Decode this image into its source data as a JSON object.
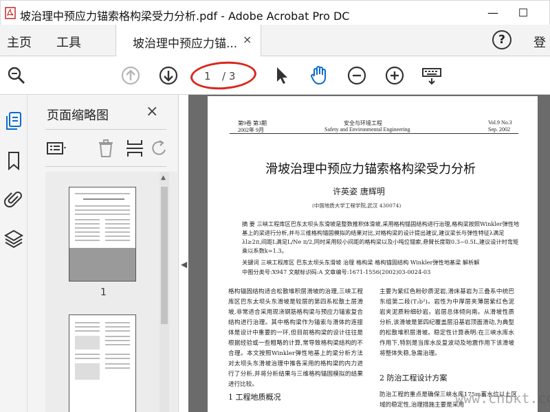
{
  "window": {
    "title": "坡治理中预应力锚索格构梁受力分析.pdf - Adobe Acrobat Pro DC",
    "minimize": "—",
    "maximize": "☐"
  },
  "menu": {
    "home": "主页",
    "tools": "工具",
    "doc_tab": "坡治理中预应力锚...",
    "doc_tab_close": "×",
    "help": "?",
    "login": "登"
  },
  "toolbar": {
    "current_page": "1",
    "total_pages": "/ 3",
    "icons": [
      "zoom-search-icon",
      "prev-page-icon",
      "next-page-icon",
      "select-arrow-icon",
      "hand-icon",
      "zoom-out-icon",
      "zoom-in-icon",
      "keyboard-icon"
    ]
  },
  "panel": {
    "title": "页面缩略图",
    "close": "×",
    "thumb_label": "1"
  },
  "colors": {
    "accent": "#0b6bcb",
    "highlight_ring": "#d9261c"
  },
  "page": {
    "header_left_1": "第9卷  第3期",
    "header_left_2": "2002年  9月",
    "header_center_1": "安全与环境工程",
    "header_center_2": "Safety and Environmental Engineering",
    "header_right_1": "Vol.9   No.3",
    "header_right_2": "Sep.   2002",
    "title": "滑坡治理中预应力锚索格构梁受力分析",
    "authors": "许英姿    唐辉明",
    "affiliation": "(中国地质大学工程学院,武汉 430074)",
    "abstract": "摘  要   三峡工程库区巴东太坝头东滑坡是整数推积体滑坡,采用格构锚固结构进行治理,格构梁按照Winkler弹性地基上的梁进行分析,并与三维格构锚固模拟的结果对比,对格构梁的设计提出建议,建议梁长与弹性特征λ满足λl≥2π,间距L满足L/Ne π/2,同时采用较小间距的格构梁以及小吨位锚索,悬臂长度取0.3~0.5L,建议设计时弯矩乘以系数k=1.3。",
    "keywords": "关键词   三峡工程库区   巴东太坝头东滑坡   治理   格构梁   格构锚固结构   Winkler弹性地基梁   解析解",
    "classification": "中图分类号:X947              文献标识码:A              文章编号:1671-1556(2002)03-0024-03",
    "col_left": "格构锚固结构适合松散堆积层滑坡的治理,三峡工程库区巴东太坝头东滑坡是较层的第四系松散土层滑坡,非常适合采用现浇钢筋格构梁与预应力锚索复合结构进行治理。其中格构梁作为锚索与滑体的连接体是设计中重要的一环,但目前格构梁的设计往往是根据经验或一些粗略的计算,常导致格构梁结构的不合理。本文按照Winkler弹性地基上的梁分析方法对太坝头东滑坡治理中推各采用的格构梁的内力进行了分析,并将分析结果与三维格构锚固模拟的结果进行比较。",
    "col_right": "主要为紫红色粉砂质泥岩,滑床基岩为三叠系中统巴东组第二段(T₂b²)。岩性为中厚层夹薄层紫红色泥岩夹泥质粉细砂岩。岩层总体倾向南。从滑坡性质分析,该滑坡是第四纪覆盖层沿基岩顶面滑动,为典型的松散堆积层滑坡。稳定性计算表明:在三峡水库水作用下,特别是当库水反复波动及地震作用下该滑坡将整体失稳,急需治理。",
    "sec_1": "1   工程地质概况",
    "sec_2": "2   防治工程设计方案",
    "col_right_tail": "防治工程的重点是确保三峡水库175m蓄水位以上区域的稳定性,治理措施主要是采用"
  },
  "watermark": "www.cnbkt.com"
}
